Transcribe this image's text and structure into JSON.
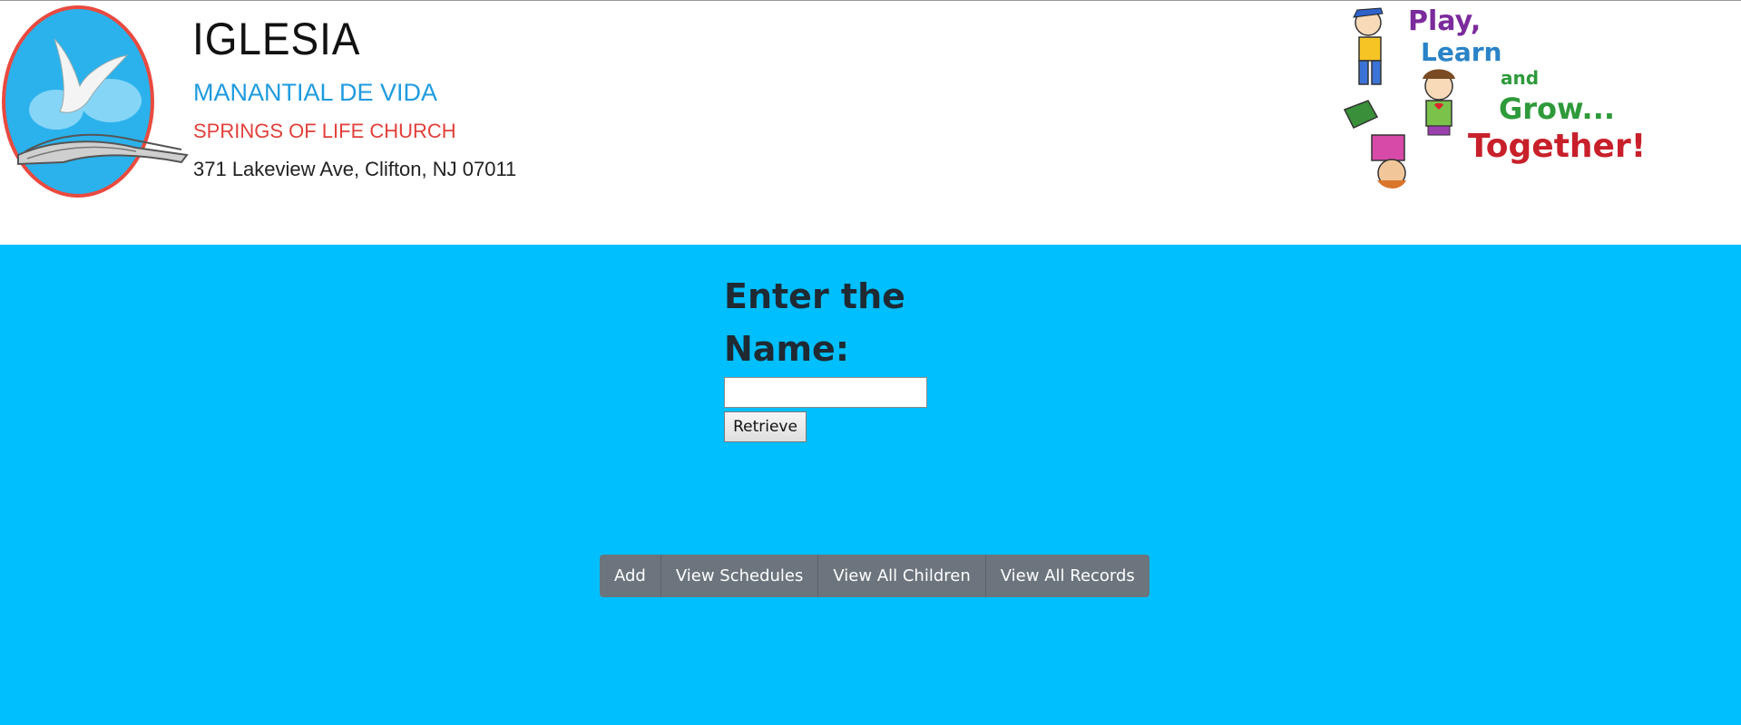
{
  "header": {
    "church": {
      "title": "IGLESIA",
      "subtitle_es": "MANANTIAL DE VIDA",
      "subtitle_en": "SPRINGS OF LIFE CHURCH",
      "address": "371 Lakeview Ave, Clifton, NJ 07011"
    },
    "kids_banner": {
      "line1": "Play,",
      "line2": "Learn",
      "line3": "and",
      "line4": "Grow...",
      "line5": "Together!"
    }
  },
  "search": {
    "prompt": "Enter the Name:",
    "input_value": "",
    "retrieve_label": "Retrieve"
  },
  "nav": {
    "buttons": [
      {
        "label": "Add"
      },
      {
        "label": "View Schedules"
      },
      {
        "label": "View All Children"
      },
      {
        "label": "View All Records"
      }
    ]
  },
  "colors": {
    "main_background": "#00bfff",
    "button_background": "#6c757d",
    "logo_blue": "#1e9be0",
    "logo_red": "#e2403a"
  }
}
